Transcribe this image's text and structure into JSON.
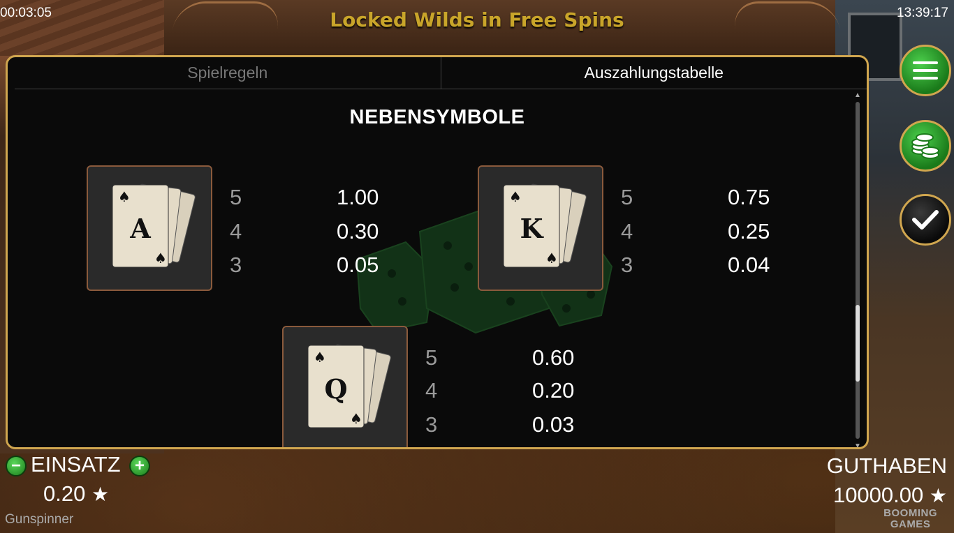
{
  "status": {
    "timer": "00:03:05",
    "clock": "13:39:17"
  },
  "game_title": "Locked Wilds in Free Spins",
  "tabs": [
    {
      "label": "Spielregeln",
      "active": false
    },
    {
      "label": "Auszahlungstabelle",
      "active": true
    }
  ],
  "section_title": "NEBENSYMBOLE",
  "symbols": [
    {
      "letter": "A",
      "icon": "ace-cards-icon",
      "payouts": [
        {
          "count": "5",
          "value": "1.00"
        },
        {
          "count": "4",
          "value": "0.30"
        },
        {
          "count": "3",
          "value": "0.05"
        }
      ]
    },
    {
      "letter": "K",
      "icon": "king-cards-icon",
      "payouts": [
        {
          "count": "5",
          "value": "0.75"
        },
        {
          "count": "4",
          "value": "0.25"
        },
        {
          "count": "3",
          "value": "0.04"
        }
      ]
    },
    {
      "letter": "Q",
      "icon": "queen-cards-icon",
      "payouts": [
        {
          "count": "5",
          "value": "0.60"
        },
        {
          "count": "4",
          "value": "0.20"
        },
        {
          "count": "3",
          "value": "0.03"
        }
      ]
    }
  ],
  "scroll_position": 0.78,
  "side_buttons": {
    "menu": "hamburger-menu-icon",
    "coins": "coins-icon",
    "confirm": "checkmark-icon"
  },
  "bet": {
    "label": "EINSATZ",
    "value": "0.20",
    "minus": "−",
    "plus": "+",
    "star": "★"
  },
  "game_name": "Gunspinner",
  "balance": {
    "label": "GUTHABEN",
    "value": "10000.00",
    "star": "★"
  },
  "brand": {
    "line1": "BOOMING",
    "line2": "GAMES"
  },
  "colors": {
    "gold_border": "#d0a64f",
    "title_gold": "#c9a52a",
    "button_green": "#2fa52f",
    "panel_bg": "#0a0a0a"
  }
}
